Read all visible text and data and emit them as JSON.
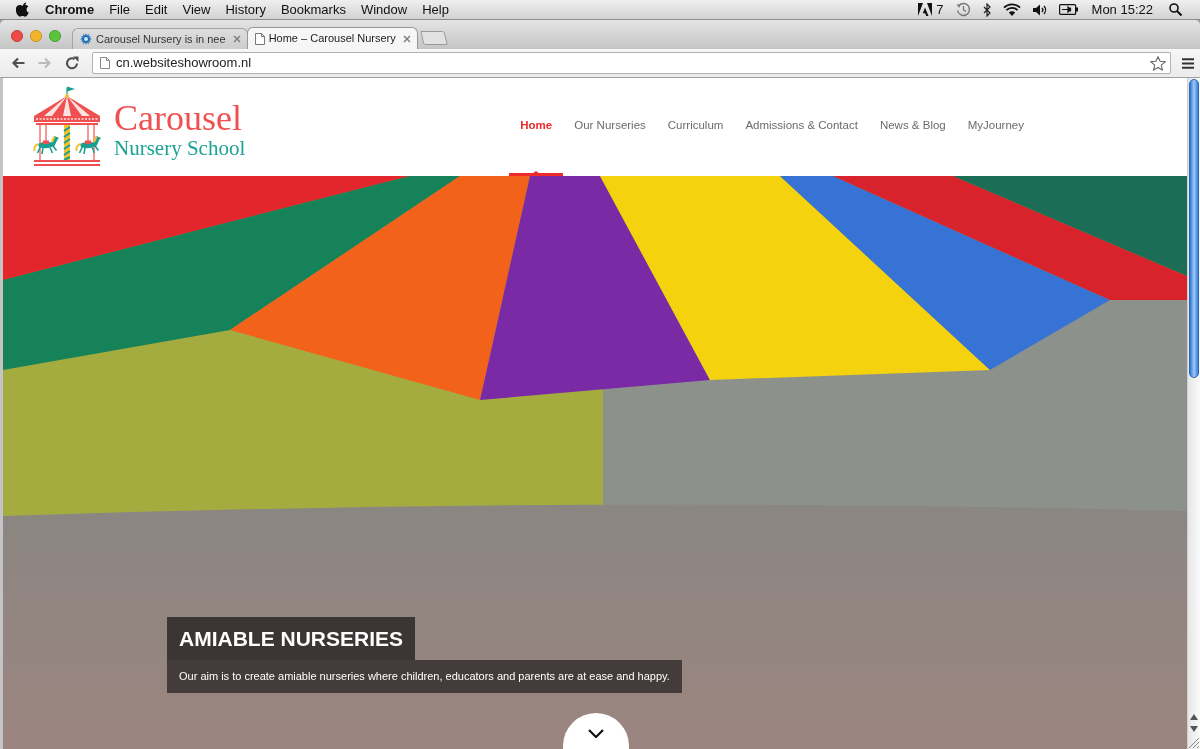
{
  "menu_bar": {
    "app_name": "Chrome",
    "menus": [
      "File",
      "Edit",
      "View",
      "History",
      "Bookmarks",
      "Window",
      "Help"
    ],
    "status_count": "7",
    "clock": "Mon 15:22"
  },
  "browser": {
    "tabs": [
      {
        "kind": "site",
        "title": "Carousel Nursery is in nee",
        "selected": false
      },
      {
        "kind": "page",
        "title": "Home – Carousel Nursery",
        "selected": true
      }
    ],
    "toolbar_buttons": [
      {
        "kind": "back",
        "disabled": false
      },
      {
        "kind": "forward",
        "disabled": true
      },
      {
        "kind": "reload",
        "disabled": false
      }
    ],
    "address": "cn.websiteshowroom.nl"
  },
  "site": {
    "logo": {
      "name": "Carousel",
      "tagline": "Nursery School"
    },
    "nav": [
      {
        "label": "Home",
        "selected": true
      },
      {
        "label": "Our Nurseries",
        "selected": false
      },
      {
        "label": "Curriculum",
        "selected": false
      },
      {
        "label": "Admissions & Contact",
        "selected": false
      },
      {
        "label": "News & Blog",
        "selected": false
      },
      {
        "label": "MyJourney",
        "selected": false
      }
    ],
    "hero": {
      "title": "AMIABLE NURSERIES",
      "text": "Our aim is to create amiable nurseries where children, educators and parents are at ease and happy."
    }
  }
}
